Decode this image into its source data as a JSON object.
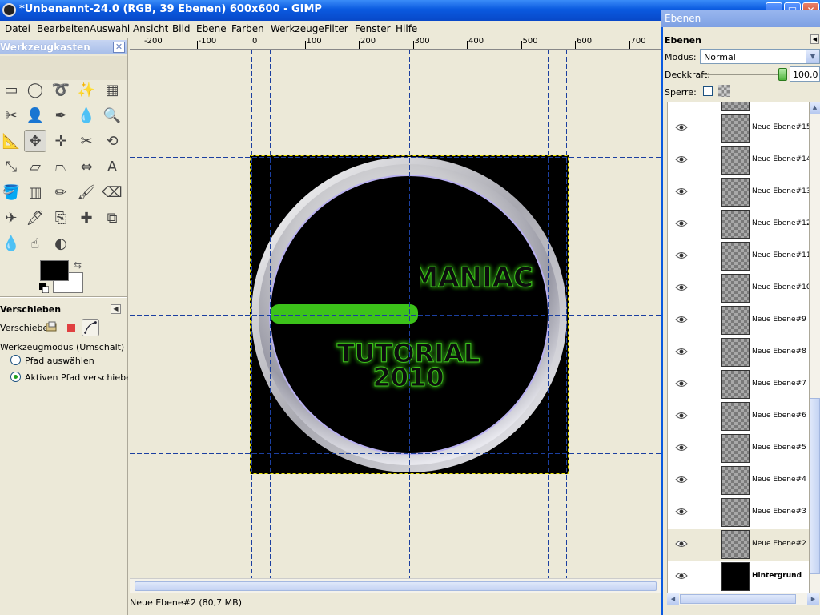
{
  "window": {
    "title": "*Unbenannt-24.0 (RGB, 39 Ebenen) 600x600 - GIMP",
    "minimize": "_",
    "maximize": "□",
    "close": "✕"
  },
  "menu": {
    "items": [
      "Datei",
      "Bearbeiten",
      "Auswahl",
      "Ansicht",
      "Bild",
      "Ebene",
      "Farben",
      "Werkzeuge",
      "Filter",
      "Fenster",
      "Hilfe"
    ]
  },
  "toolbox": {
    "title": "Werkzeugkasten",
    "close": "✕",
    "tools": [
      {
        "name": "rect-select-icon",
        "glyph": "▭"
      },
      {
        "name": "ellipse-select-icon",
        "glyph": "◯"
      },
      {
        "name": "free-select-icon",
        "glyph": "➰"
      },
      {
        "name": "fuzzy-select-icon",
        "glyph": "✨"
      },
      {
        "name": "color-select-icon",
        "glyph": "▦"
      },
      {
        "name": "scissors-icon",
        "glyph": "✂"
      },
      {
        "name": "foreground-select-icon",
        "glyph": "👤"
      },
      {
        "name": "paths-icon",
        "glyph": "✒"
      },
      {
        "name": "color-picker-icon",
        "glyph": "💧"
      },
      {
        "name": "zoom-icon",
        "glyph": "🔍"
      },
      {
        "name": "measure-icon",
        "glyph": "📐"
      },
      {
        "name": "move-icon",
        "glyph": "✥"
      },
      {
        "name": "align-icon",
        "glyph": "✛"
      },
      {
        "name": "crop-icon",
        "glyph": "✂"
      },
      {
        "name": "rotate-icon",
        "glyph": "⟲"
      },
      {
        "name": "scale-icon",
        "glyph": "⤡"
      },
      {
        "name": "shear-icon",
        "glyph": "▱"
      },
      {
        "name": "perspective-icon",
        "glyph": "⏢"
      },
      {
        "name": "flip-icon",
        "glyph": "⇔"
      },
      {
        "name": "text-icon",
        "glyph": "A"
      },
      {
        "name": "bucket-fill-icon",
        "glyph": "🪣"
      },
      {
        "name": "blend-icon",
        "glyph": "▥"
      },
      {
        "name": "pencil-icon",
        "glyph": "✏"
      },
      {
        "name": "paintbrush-icon",
        "glyph": "🖌"
      },
      {
        "name": "eraser-icon",
        "glyph": "⌫"
      },
      {
        "name": "airbrush-icon",
        "glyph": "✈"
      },
      {
        "name": "ink-icon",
        "glyph": "🖋"
      },
      {
        "name": "clone-icon",
        "glyph": "⎘"
      },
      {
        "name": "heal-icon",
        "glyph": "✚"
      },
      {
        "name": "perspective-clone-icon",
        "glyph": "⧉"
      },
      {
        "name": "blur-icon",
        "glyph": "💧"
      },
      {
        "name": "smudge-icon",
        "glyph": "☝"
      },
      {
        "name": "dodge-burn-icon",
        "glyph": "◐"
      }
    ],
    "colors": {
      "foreground": "#000000",
      "background": "#ffffff"
    },
    "options": {
      "title": "Verschieben",
      "move_label": "Verschieben:",
      "mode_label": "Werkzeugmodus (Umschalt)",
      "radio1": "Pfad auswählen",
      "radio2": "Aktiven Pfad verschieben",
      "selected": "radio2"
    }
  },
  "ruler": {
    "labels": [
      "-200",
      "-100",
      "0",
      "100",
      "200",
      "300",
      "400",
      "500",
      "600",
      "700"
    ]
  },
  "canvas": {
    "texts": {
      "line1": "MANIAC",
      "line2": "TUTORIAL",
      "line3": "2010"
    },
    "accent": "#3cc21a"
  },
  "status": {
    "text": "Neue Ebene#2 (80,7 MB)"
  },
  "layers_dialog": {
    "window_title": "Ebenen",
    "tab": "Ebenen",
    "mode_label": "Modus:",
    "mode_value": "Normal",
    "opacity_label": "Deckkraft:",
    "opacity_value": "100,0",
    "opacity": 1.0,
    "lock_label": "Sperre:",
    "layers": [
      {
        "name": "Neue Ebene#15",
        "selected": false,
        "bold": false
      },
      {
        "name": "Neue Ebene#14",
        "selected": false,
        "bold": false
      },
      {
        "name": "Neue Ebene#13",
        "selected": false,
        "bold": false
      },
      {
        "name": "Neue Ebene#12",
        "selected": false,
        "bold": false
      },
      {
        "name": "Neue Ebene#11",
        "selected": false,
        "bold": false
      },
      {
        "name": "Neue Ebene#10",
        "selected": false,
        "bold": false
      },
      {
        "name": "Neue Ebene#9",
        "selected": false,
        "bold": false
      },
      {
        "name": "Neue Ebene#8",
        "selected": false,
        "bold": false
      },
      {
        "name": "Neue Ebene#7",
        "selected": false,
        "bold": false
      },
      {
        "name": "Neue Ebene#6",
        "selected": false,
        "bold": false
      },
      {
        "name": "Neue Ebene#5",
        "selected": false,
        "bold": false
      },
      {
        "name": "Neue Ebene#4",
        "selected": false,
        "bold": false
      },
      {
        "name": "Neue Ebene#3",
        "selected": false,
        "bold": false
      },
      {
        "name": "Neue Ebene#2",
        "selected": true,
        "bold": false
      },
      {
        "name": "Hintergrund",
        "selected": false,
        "bold": true
      }
    ]
  }
}
